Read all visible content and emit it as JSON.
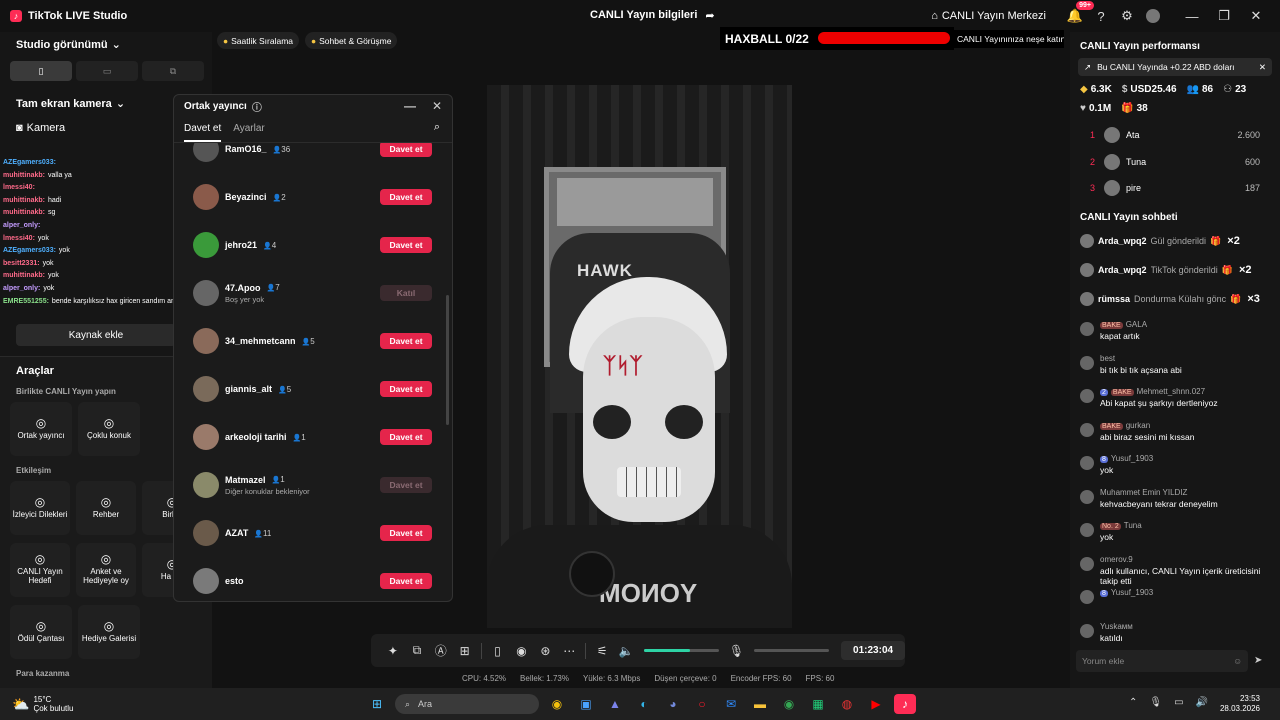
{
  "titlebar": {
    "app_name": "TikTok LIVE Studio",
    "center_title": "CANLI Yayın bilgileri",
    "live_center_label": "CANLI Yayın Merkezi",
    "notification_badge": "99+"
  },
  "left_panel": {
    "studio_view_title": "Studio görünümü",
    "camera_section_title": "Tam ekran kamera",
    "camera_source": "Kamera",
    "chat_lines": [
      {
        "user": "AZEgamers033:",
        "text": "",
        "color": "#4fb0ff"
      },
      {
        "user": "muhittinakb:",
        "text": "valla ya",
        "color": "#ff6a8a"
      },
      {
        "user": "lmessi40:",
        "text": "",
        "color": "#ff6a8a"
      },
      {
        "user": "muhittinakb:",
        "text": "hadi",
        "color": "#ff6a8a"
      },
      {
        "user": "muhittinakb:",
        "text": "sg",
        "color": "#ff6a8a"
      },
      {
        "user": "alper_only:",
        "text": "",
        "color": "#c49cff"
      },
      {
        "user": "lmessi40:",
        "text": "yok",
        "color": "#ff6a8a"
      },
      {
        "user": "AZEgamers033:",
        "text": "yok",
        "color": "#4fb0ff"
      },
      {
        "user": "besitt2331:",
        "text": "yok",
        "color": "#ff6a8a"
      },
      {
        "user": "muhittinakb:",
        "text": "yok",
        "color": "#ff6a8a"
      },
      {
        "user": "alper_only:",
        "text": "yok",
        "color": "#c49cff"
      },
      {
        "user": "EMRE551255:",
        "text": "bende karşılıksız hax giricen sandım amk",
        "color": "#8ae08a"
      }
    ],
    "add_source_button": "Kaynak ekle",
    "tools_title": "Araçlar",
    "together_title": "Birlikte CANLI Yayın yapın",
    "tools_together": [
      {
        "label": "Ortak yayıncı",
        "icon": "link-icon"
      },
      {
        "label": "Çoklu konuk",
        "icon": "users-icon"
      }
    ],
    "interaction_title": "Etkileşim",
    "tools_interaction": [
      {
        "label": "İzleyici Dilekleri",
        "icon": "wish-icon"
      },
      {
        "label": "Rehber",
        "icon": "book-icon"
      },
      {
        "label": "Birlikt",
        "icon": "group-icon"
      }
    ],
    "tools_row3": [
      {
        "label": "CANLI Yayın Hedefi",
        "icon": "goal-icon"
      },
      {
        "label": "Anket ve Hediyeyle oy",
        "icon": "poll-icon"
      },
      {
        "label": "Ha Ku",
        "icon": "tool-icon"
      }
    ],
    "tools_row4": [
      {
        "label": "Ödül Çantası",
        "icon": "bag-icon"
      },
      {
        "label": "Hediye Galerisi",
        "icon": "gallery-icon"
      }
    ],
    "earn_title": "Para kazanma"
  },
  "top_buttons": {
    "hourly_ranking": "Saatlik Sıralama",
    "chat_meet": "Sohbet & Görüşme"
  },
  "overlay": {
    "haxball_label": "HAXBALL 0/22",
    "ticker_text": "CANLI Yayınınıza neşe katın"
  },
  "popup": {
    "title": "Ortak yayıncı",
    "tab_invite": "Davet et",
    "tab_settings": "Ayarlar",
    "rows": [
      {
        "name": "RamO16_",
        "count": "36",
        "sub": "",
        "button": "Davet et",
        "disabled": false,
        "color": "#555"
      },
      {
        "name": "Beyazinci",
        "count": "2",
        "sub": "",
        "button": "Davet et",
        "disabled": false,
        "color": "#8a5a4a"
      },
      {
        "name": "jehro21",
        "count": "4",
        "sub": "",
        "button": "Davet et",
        "disabled": false,
        "color": "#3a9a3a"
      },
      {
        "name": "47.Apoo",
        "count": "7",
        "sub": "Boş yer yok",
        "button": "Katıl",
        "disabled": true,
        "color": "#666"
      },
      {
        "name": "34_mehmetcann",
        "count": "5",
        "sub": "",
        "button": "Davet et",
        "disabled": false,
        "color": "#8a6a5a"
      },
      {
        "name": "giannis_alt",
        "count": "5",
        "sub": "",
        "button": "Davet et",
        "disabled": false,
        "color": "#7a6a5a"
      },
      {
        "name": "arkeoloji tarihi",
        "count": "1",
        "sub": "",
        "button": "Davet et",
        "disabled": false,
        "color": "#9a7a6a"
      },
      {
        "name": "Matmazel",
        "count": "1",
        "sub": "Diğer konuklar bekleniyor",
        "button": "Davet et",
        "disabled": true,
        "color": "#8a8a6a"
      },
      {
        "name": "AZAT",
        "count": "11",
        "sub": "",
        "button": "Davet et",
        "disabled": false,
        "color": "#6a5a4a"
      },
      {
        "name": "esto",
        "count": "",
        "sub": "",
        "button": "Davet et",
        "disabled": false,
        "color": "#7a7a7a"
      }
    ]
  },
  "video": {
    "chair_brand": "HAWK",
    "shirt_text": "YONOM"
  },
  "controls": {
    "volume_level": 0.62,
    "timer": "01:23:04"
  },
  "stats": {
    "cpu": "CPU: 4.52%",
    "memory": "Bellek: 1.73%",
    "upload": "Yükle: 6.3 Mbps",
    "dropped": "Düşen çerçeve: 0",
    "encoder_fps": "Encoder FPS: 60",
    "fps": "FPS: 60"
  },
  "right_panel": {
    "performance_title": "CANLI Yayın performansı",
    "earnings_banner": "Bu CANLI Yayında +0.22 ABD doları",
    "stats": [
      {
        "icon": "diamond-icon",
        "value": "6.3K"
      },
      {
        "icon": "coin-icon",
        "value": "USD25.46"
      },
      {
        "icon": "viewers-icon",
        "value": "86"
      },
      {
        "icon": "follow-icon",
        "value": "23"
      },
      {
        "icon": "heart-icon",
        "value": "0.1M"
      },
      {
        "icon": "gift-icon",
        "value": "38"
      }
    ],
    "ranking": [
      {
        "rank": "1",
        "name": "Ata",
        "value": "2.600"
      },
      {
        "rank": "2",
        "name": "Tuna",
        "value": "600"
      },
      {
        "rank": "3",
        "name": "pire",
        "value": "187"
      }
    ],
    "chat_title": "CANLI Yayın sohbeti",
    "gifts": [
      {
        "user": "Arda_wpq2",
        "desc": "Gül gönderildi",
        "mult": "×2"
      },
      {
        "user": "Arda_wpq2",
        "desc": "TikTok gönderildi",
        "mult": "×2"
      },
      {
        "user": "rümssa",
        "desc": "Dondurma Külahı gönc",
        "mult": "×3"
      }
    ],
    "messages": [
      {
        "badges": [
          "BAKE"
        ],
        "level": "",
        "user": "GALA",
        "text": "kapat artık"
      },
      {
        "badges": [],
        "level": "",
        "user": "best",
        "text": "bi tık bi tık açsana abi"
      },
      {
        "badges": [
          "BAKE"
        ],
        "level": "2",
        "user": "Mehmett_shnn.027",
        "text": "Abi kapat şu şarkıyı dertleniyoz"
      },
      {
        "badges": [
          "BAKE"
        ],
        "level": "",
        "user": "gurkan",
        "text": "abi biraz sesini mi kıssan"
      },
      {
        "badges": [],
        "level": "8",
        "user": "Yusuf_1903",
        "text": "yok"
      },
      {
        "badges": [],
        "level": "",
        "user": "Muhammet Emin YILDIZ",
        "text": "kehvacbeyanı tekrar deneyelim"
      },
      {
        "badges": [
          "No. 2"
        ],
        "level": "",
        "user": "Tuna",
        "text": "yok"
      },
      {
        "badges": [],
        "level": "",
        "user": "omerov.9",
        "text": "adlı kullanıcı, CANLI Yayın içerik üreticisini takip etti"
      },
      {
        "badges": [],
        "level": "8",
        "user": "Yusuf_1903",
        "text": ""
      },
      {
        "badges": [],
        "level": "",
        "user": "Yuskaмм",
        "text": "katıldı"
      }
    ],
    "comment_placeholder": "Yorum ekle"
  },
  "taskbar": {
    "temperature": "15°C",
    "weather": "Çok bulutlu",
    "search_placeholder": "Ara",
    "time": "23:53",
    "date": "28.03.2026"
  }
}
